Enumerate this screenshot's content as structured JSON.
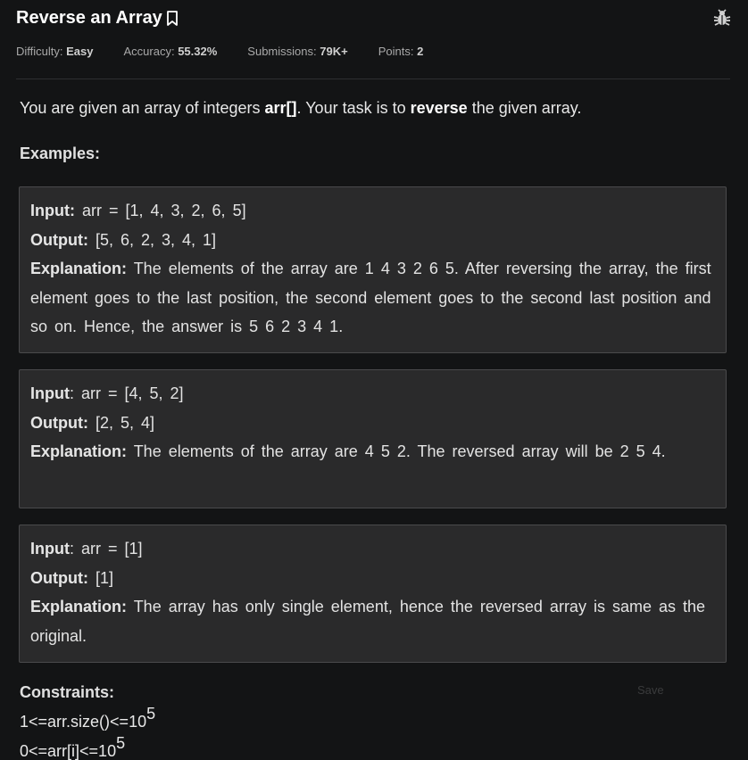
{
  "header": {
    "title": "Reverse an Array",
    "bookmark_icon": "bookmark-icon",
    "bug_icon": "bug-icon"
  },
  "meta": {
    "difficulty_label": "Difficulty:",
    "difficulty_value": "Easy",
    "accuracy_label": "Accuracy:",
    "accuracy_value": "55.32%",
    "submissions_label": "Submissions:",
    "submissions_value": "79K+",
    "points_label": "Points:",
    "points_value": "2"
  },
  "intro": {
    "part1": "You are given an array of integers ",
    "bold1": "arr[]",
    "part2": ". Your task is to ",
    "bold2": "reverse",
    "part3": " the given array."
  },
  "examples_heading": "Examples:",
  "examples": [
    {
      "input_label": "Input:",
      "input_value": " arr = [1, 4, 3, 2, 6, 5]",
      "output_label": "Output:",
      "output_value": " [5, 6, 2, 3, 4, 1]",
      "explanation_label": "Explanation:",
      "explanation_value": " The elements of the array are 1 4 3 2 6 5. After reversing the array, the first element goes to the last position, the second element goes to the second last position and so on. Hence, the answer is 5 6 2 3 4 1."
    },
    {
      "input_label": "Input",
      "input_value": ": arr = [4, 5, 2]",
      "output_label": "Output:",
      "output_value": " [2, 5, 4]",
      "explanation_label": "Explanation:",
      "explanation_value": " The elements of the array are 4 5 2. The reversed array will be 2 5 4."
    },
    {
      "input_label": "Input",
      "input_value": ": arr = [1]",
      "output_label": "Output:",
      "output_value": " [1]",
      "explanation_label": "Explanation:",
      "explanation_value": " The array has only single element, hence the reversed array is same as the original."
    }
  ],
  "constraints_heading": "Constraints:",
  "save_label": "Save",
  "constraints": [
    {
      "base": "1<=arr.size()<=10",
      "exp": "5"
    },
    {
      "base": "0<=arr[i]<=10",
      "exp": "5"
    }
  ]
}
